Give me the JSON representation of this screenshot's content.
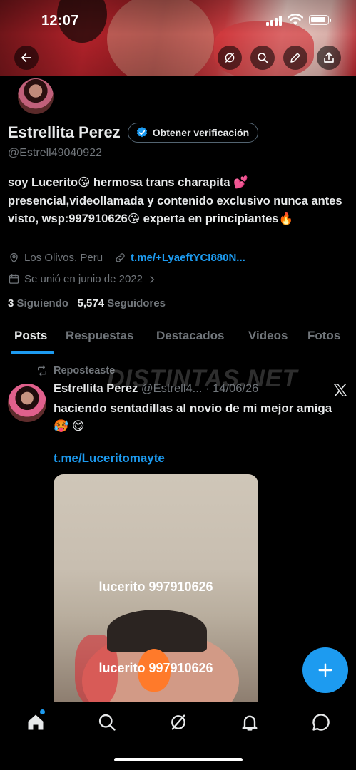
{
  "status": {
    "time": "12:07"
  },
  "header": {
    "back_icon": "arrow-left-icon",
    "grok_icon": "grok-icon",
    "search_icon": "search-icon",
    "edit_icon": "pencil-icon",
    "share_icon": "share-icon"
  },
  "profile": {
    "display_name": "Estrellita Perez",
    "verify_label": "Obtener verificación",
    "handle": "@Estrell49040922",
    "bio": "soy Lucerito😘 hermosa trans charapita 💕 presencial,videollamada y contenido exclusivo nunca antes visto, wsp:997910626😘 experta en principiantes🔥",
    "location": "Los Olivos, Peru",
    "link": "t.me/+LyaeftYCI880N...",
    "joined": "Se unió en junio de 2022",
    "following_count": "3",
    "following_label": "Siguiendo",
    "followers_count": "5,574",
    "followers_label": "Seguidores"
  },
  "tabs": [
    {
      "label": "Posts",
      "active": true
    },
    {
      "label": "Respuestas",
      "active": false
    },
    {
      "label": "Destacados",
      "active": false
    },
    {
      "label": "Videos",
      "active": false
    },
    {
      "label": "Fotos",
      "active": false
    }
  ],
  "post": {
    "repost_label": "Reposteaste",
    "watermark": "DISTINTAS.NET",
    "author_name": "Estrellita Perez",
    "author_handle": "@Estrell4...",
    "date": "· 14/06/26",
    "text": "haciendo sentadillas al novio de mi mejor amiga 🥵 😋",
    "link": "t.me/Luceritomayte",
    "media_watermark_1": "lucerito 997910626",
    "media_watermark_2": "lucerito 997910626"
  },
  "nav": {
    "items": [
      "home-icon",
      "search-icon",
      "grok-icon",
      "bell-icon",
      "messages-icon"
    ]
  },
  "colors": {
    "accent": "#1d9bf0",
    "background": "#000000",
    "text_primary": "#e7e9ea",
    "text_secondary": "#71767b"
  }
}
